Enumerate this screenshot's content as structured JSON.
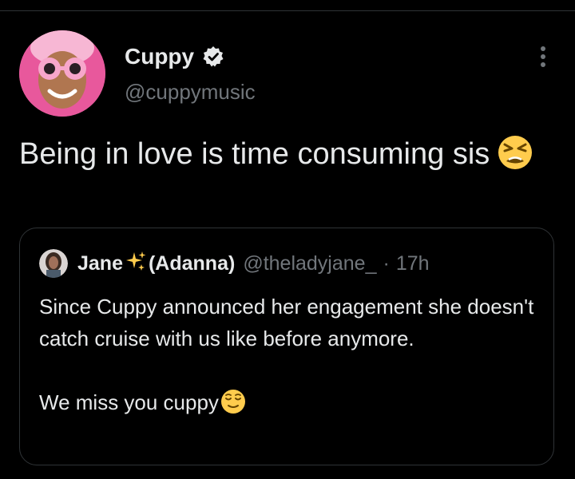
{
  "tweet": {
    "author_name": "Cuppy",
    "author_handle": "@cuppymusic",
    "text": "Being in love is time consuming sis",
    "emoji_name": "tired-face-emoji"
  },
  "quoted_tweet": {
    "author_name_first": "Jane",
    "author_name_second": "(Adanna)",
    "author_handle": "@theladyjane_",
    "separator": "·",
    "time": "17h",
    "body_lines": [
      "Since Cuppy announced her engagement she doesn't catch cruise with us like before anymore.",
      "We miss you cuppy"
    ],
    "emoji_name": "relieved-face-emoji"
  },
  "icons": {
    "verified": "verified-badge-icon",
    "more": "more-options-icon",
    "sparkles": "sparkles-icon"
  },
  "colors": {
    "background": "#000000",
    "text_primary": "#e7e9ea",
    "text_secondary": "#71767b",
    "border": "#2f3336",
    "emoji_yellow": "#ffcc4d"
  }
}
